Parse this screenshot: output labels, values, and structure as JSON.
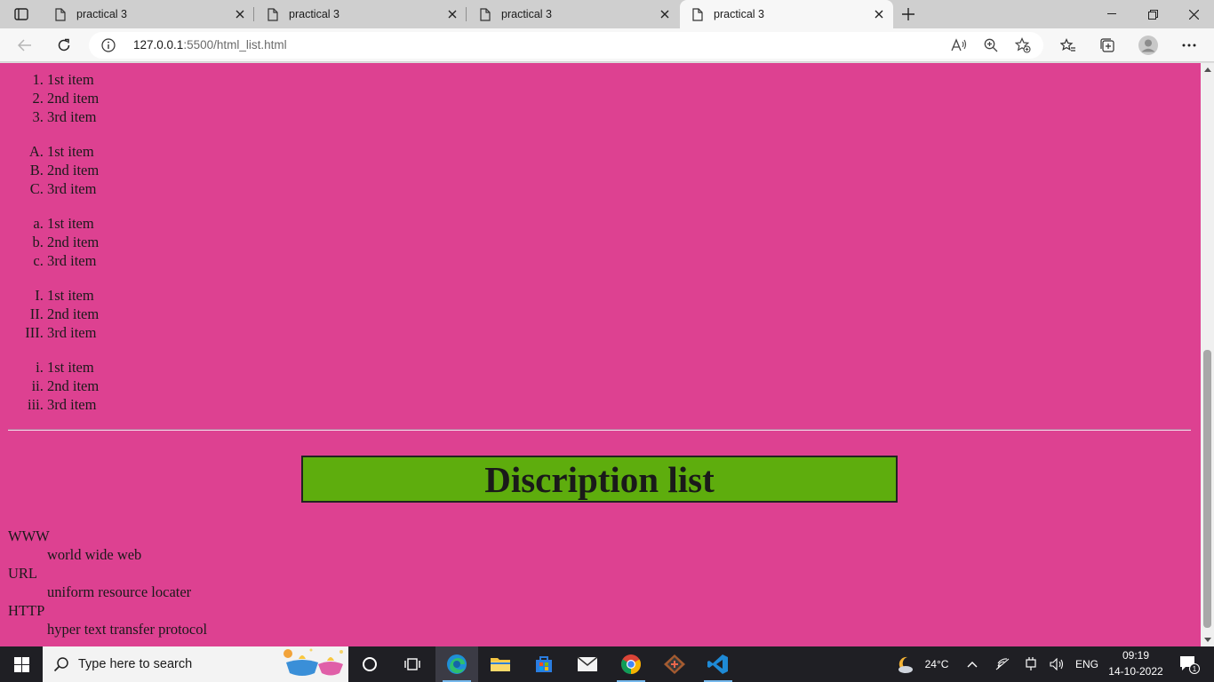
{
  "browser": {
    "tabs": [
      {
        "title": "practical 3"
      },
      {
        "title": "practical 3"
      },
      {
        "title": "practical 3"
      },
      {
        "title": "practical 3"
      }
    ],
    "address": {
      "host": "127.0.0.1",
      "path": ":5500/html_list.html"
    }
  },
  "page": {
    "ordered_lists": [
      {
        "markers": [
          "1.",
          "2.",
          "3."
        ],
        "items": [
          "1st item",
          "2nd item",
          "3rd item"
        ]
      },
      {
        "markers": [
          "A.",
          "B.",
          "C."
        ],
        "items": [
          "1st item",
          "2nd item",
          "3rd item"
        ]
      },
      {
        "markers": [
          "a.",
          "b.",
          "c."
        ],
        "items": [
          "1st item",
          "2nd item",
          "3rd item"
        ]
      },
      {
        "markers": [
          "I.",
          "II.",
          "III."
        ],
        "items": [
          "1st item",
          "2nd item",
          "3rd item"
        ]
      },
      {
        "markers": [
          "i.",
          "ii.",
          "iii."
        ],
        "items": [
          "1st item",
          "2nd item",
          "3rd item"
        ]
      }
    ],
    "heading": "Discription list",
    "description_list": [
      {
        "term": "WWW",
        "definition": "world wide web"
      },
      {
        "term": "URL",
        "definition": "uniform resource locater"
      },
      {
        "term": "HTTP",
        "definition": "hyper text transfer protocol"
      }
    ],
    "colors": {
      "background": "#dd4191",
      "heading_box": "#5ead0d"
    }
  },
  "taskbar": {
    "search_placeholder": "Type here to search",
    "weather": "24°C",
    "language": "ENG",
    "time": "09:19",
    "date": "14-10-2022",
    "notification_count": "1"
  }
}
